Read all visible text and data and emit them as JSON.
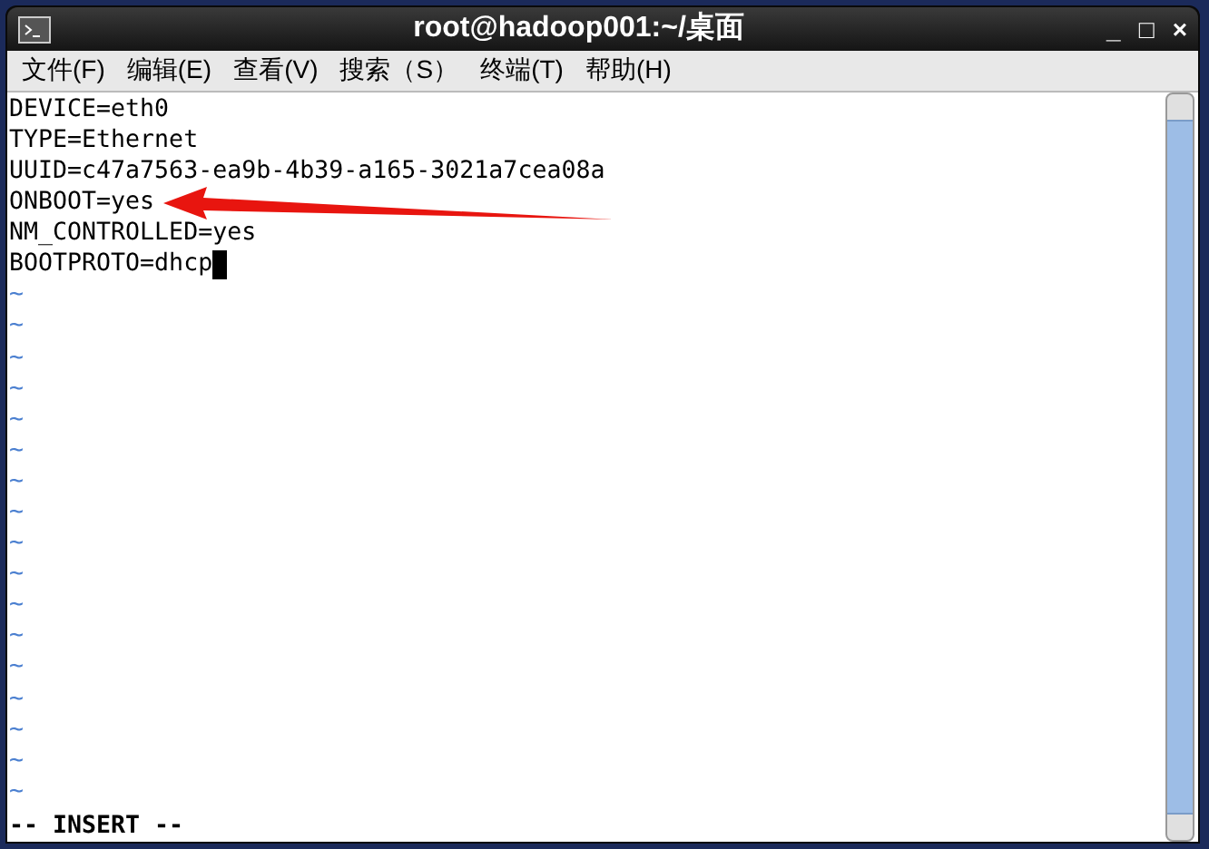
{
  "window": {
    "title": "root@hadoop001:~/桌面",
    "controls": [
      "_",
      "□",
      "×"
    ]
  },
  "menu": [
    "文件(F)",
    "编辑(E)",
    "查看(V)",
    "搜索（S）",
    "终端(T)",
    "帮助(H)"
  ],
  "editor": {
    "lines": [
      {
        "text": "DEVICE=eth0",
        "cursor": false
      },
      {
        "text": "TYPE=Ethernet",
        "cursor": false
      },
      {
        "text": "UUID=c47a7563-ea9b-4b39-a165-3021a7cea08a",
        "cursor": false
      },
      {
        "text": "ONBOOT=yes",
        "cursor": false
      },
      {
        "text": "NM_CONTROLLED=yes",
        "cursor": false
      },
      {
        "text": "BOOTPROTO=dhcp",
        "cursor": true
      }
    ],
    "empty_lines": [
      "~",
      "~",
      "~",
      "~",
      "~",
      "~",
      "~",
      "~",
      "~",
      "~",
      "~",
      "~",
      "~",
      "~",
      "~",
      "~",
      "~"
    ],
    "status": "-- INSERT --"
  }
}
